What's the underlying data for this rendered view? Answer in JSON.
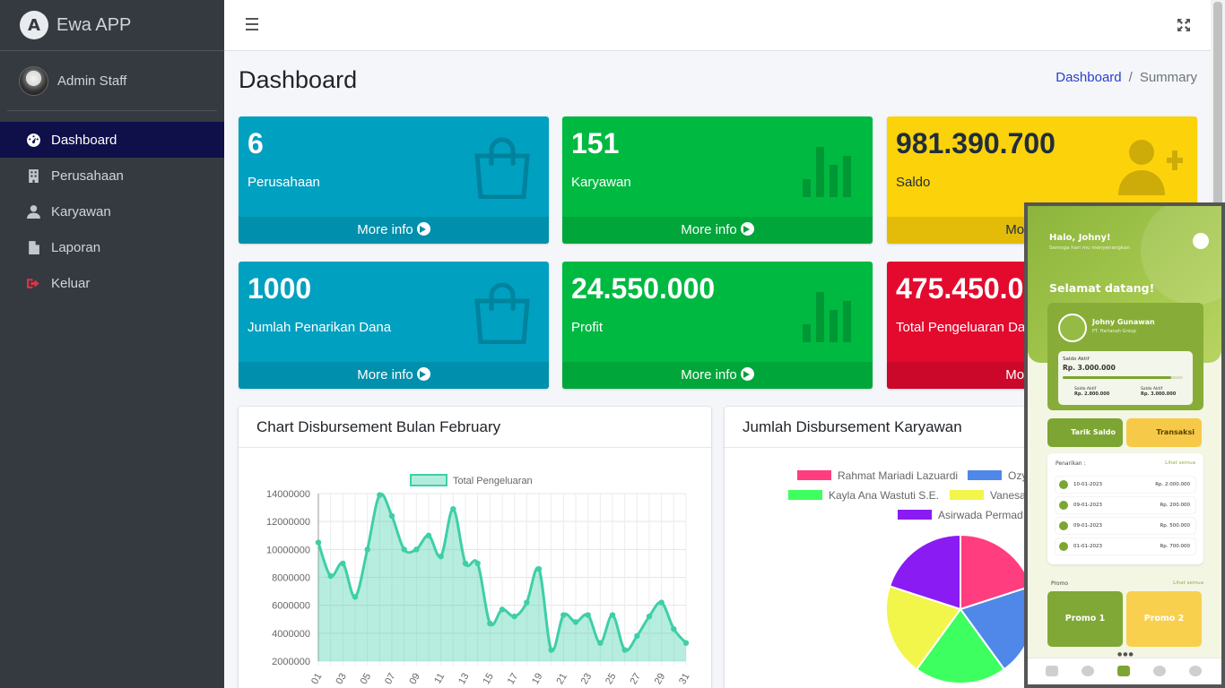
{
  "app": {
    "brand": "Ewa APP",
    "logo_letter": "A",
    "user_name": "Admin Staff"
  },
  "sidebar": {
    "items": [
      {
        "label": "Dashboard",
        "icon": "tachometer-icon",
        "active": true
      },
      {
        "label": "Perusahaan",
        "icon": "building-icon"
      },
      {
        "label": "Karyawan",
        "icon": "user-icon"
      },
      {
        "label": "Laporan",
        "icon": "file-icon"
      },
      {
        "label": "Keluar",
        "icon": "sign-out-icon"
      }
    ]
  },
  "header": {
    "title": "Dashboard",
    "breadcrumb": [
      "Dashboard",
      "Summary"
    ]
  },
  "boxes": [
    {
      "value": "6",
      "label": "Perusahaan",
      "more": "More info",
      "color": "#00a0c0",
      "icon": "shopping-bag-icon"
    },
    {
      "value": "151",
      "label": "Karyawan",
      "more": "More info",
      "color": "#00b941",
      "icon": "bar-chart-icon"
    },
    {
      "value": "981.390.700",
      "label": "Saldo",
      "more": "More info",
      "color": "#fcd20a",
      "icon": "user-plus-icon"
    },
    {
      "value": "1000",
      "label": "Jumlah Penarikan Dana",
      "more": "More info",
      "color": "#00a0c0",
      "icon": "shopping-bag-icon"
    },
    {
      "value": "24.550.000",
      "label": "Profit",
      "more": "More info",
      "color": "#00b941",
      "icon": "bar-chart-icon"
    },
    {
      "value": "475.450.000",
      "label": "Total Pengeluaran Dana",
      "more": "More info",
      "color": "#e30a2e",
      "icon": "pie-chart-icon"
    }
  ],
  "cards": {
    "line_title": "Chart Disbursement Bulan February",
    "pie_title": "Jumlah Disbursement Karyawan"
  },
  "chart_data": [
    {
      "type": "area",
      "legend": [
        "Total Pengeluaran"
      ],
      "x": [
        "01",
        "02",
        "03",
        "04",
        "05",
        "06",
        "07",
        "08",
        "09",
        "10",
        "11",
        "12",
        "13",
        "14",
        "15",
        "16",
        "17",
        "18",
        "19",
        "20",
        "21",
        "22",
        "23",
        "24",
        "25",
        "26",
        "27",
        "28",
        "29",
        "30",
        "31"
      ],
      "x_tick_labels": [
        "01",
        "03",
        "05",
        "07",
        "09",
        "11",
        "13",
        "15",
        "17",
        "19",
        "21",
        "23",
        "25",
        "27",
        "29",
        "31"
      ],
      "series": [
        {
          "name": "Total Pengeluaran",
          "color": "#3ecfa7",
          "values": [
            10500000,
            8100000,
            9000000,
            6600000,
            10000000,
            13900000,
            12400000,
            10000000,
            10000000,
            11000000,
            9500000,
            12900000,
            9000000,
            9000000,
            4700000,
            5700000,
            5200000,
            6200000,
            8600000,
            2800000,
            5300000,
            4800000,
            5300000,
            3300000,
            5300000,
            2800000,
            3800000,
            5200000,
            6200000,
            4300000,
            3300000
          ]
        }
      ],
      "yticks": [
        2000000,
        4000000,
        6000000,
        8000000,
        10000000,
        12000000,
        14000000
      ],
      "ylim": [
        2000000,
        14000000
      ]
    },
    {
      "type": "pie",
      "legend": [
        "Rahmat Mariadi Lazuardi",
        "Ozy",
        "Kayla Ana Wastuti S.E.",
        "Vanesa",
        "Asirwada Permad"
      ],
      "slices": [
        {
          "name": "Rahmat Mariadi Lazuardi",
          "value": 20,
          "color": "#ff3d7f"
        },
        {
          "name": "Ozy",
          "value": 20,
          "color": "#4f88e8"
        },
        {
          "name": "Kayla Ana Wastuti S.E.",
          "value": 20,
          "color": "#3dff5f"
        },
        {
          "name": "Vanesa",
          "value": 20,
          "color": "#f2f54a"
        },
        {
          "name": "Asirwada Permad",
          "value": 20,
          "color": "#8a1bf2"
        }
      ]
    }
  ],
  "mobile": {
    "greeting": "Halo, Johny!",
    "sub": "Semoga hari mu menyenangkan",
    "welcome": "Selamat datang!",
    "name": "Johny Gunawan",
    "company": "PT. Hartanah Group",
    "saldo_label": "Saldo Aktif",
    "saldo_value": "Rp. 3.000.000",
    "saldo_progress": 0.9,
    "mini_left_label": "Saldo Aktif",
    "mini_left_value": "Rp. 2.800.000",
    "mini_right_label": "Saldo Aktif",
    "mini_right_value": "Rp. 3.000.000",
    "btn_tarik": "Tarik Saldo",
    "btn_trans": "Transaksi",
    "list_title": "Penarikan :",
    "list_all": "Lihat semua",
    "rows": [
      {
        "date": "10-01-2023",
        "amount": "Rp. 2.000.000"
      },
      {
        "date": "09-01-2023",
        "amount": "Rp. 200.000"
      },
      {
        "date": "09-01-2023",
        "amount": "Rp. 500.000"
      },
      {
        "date": "01-01-2023",
        "amount": "Rp. 700.000"
      }
    ],
    "promo_title": "Promo",
    "promo_all": "Lihat semua",
    "promo1": "Promo 1",
    "promo2": "Promo 2"
  }
}
